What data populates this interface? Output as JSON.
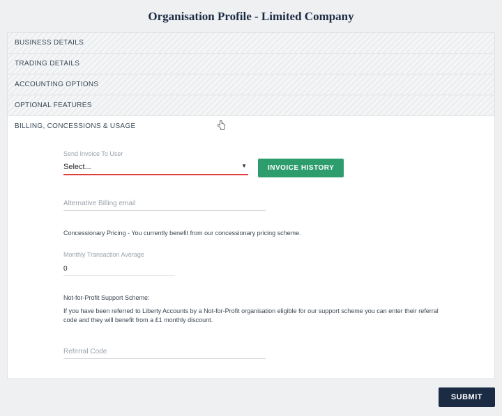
{
  "page": {
    "title": "Organisation Profile - Limited Company"
  },
  "accordion": {
    "items": [
      {
        "label": "BUSINESS DETAILS"
      },
      {
        "label": "TRADING DETAILS"
      },
      {
        "label": "ACCOUNTING OPTIONS"
      },
      {
        "label": "OPTIONAL FEATURES"
      },
      {
        "label": "BILLING, CONCESSIONS & USAGE"
      }
    ]
  },
  "billing": {
    "send_invoice_label": "Send Invoice To User",
    "send_invoice_value": "Select...",
    "invoice_history_label": "INVOICE HISTORY",
    "alt_email_placeholder": "Alternative Billing email",
    "alt_email_value": "",
    "concessionary_note": "Concessionary Pricing - You currently benefit from our concessionary pricing scheme.",
    "monthly_avg_label": "Monthly Transaction Average",
    "monthly_avg_value": "0",
    "nfp_heading": "Not-for-Profit Support Scheme:",
    "nfp_note": "If you have been referred to Liberty Accounts by a Not-for-Profit organisation eligible for our support scheme you can enter their referral code and they will benefit from a £1 monthly discount.",
    "referral_placeholder": "Referral Code",
    "referral_value": ""
  },
  "actions": {
    "submit_label": "SUBMIT"
  }
}
